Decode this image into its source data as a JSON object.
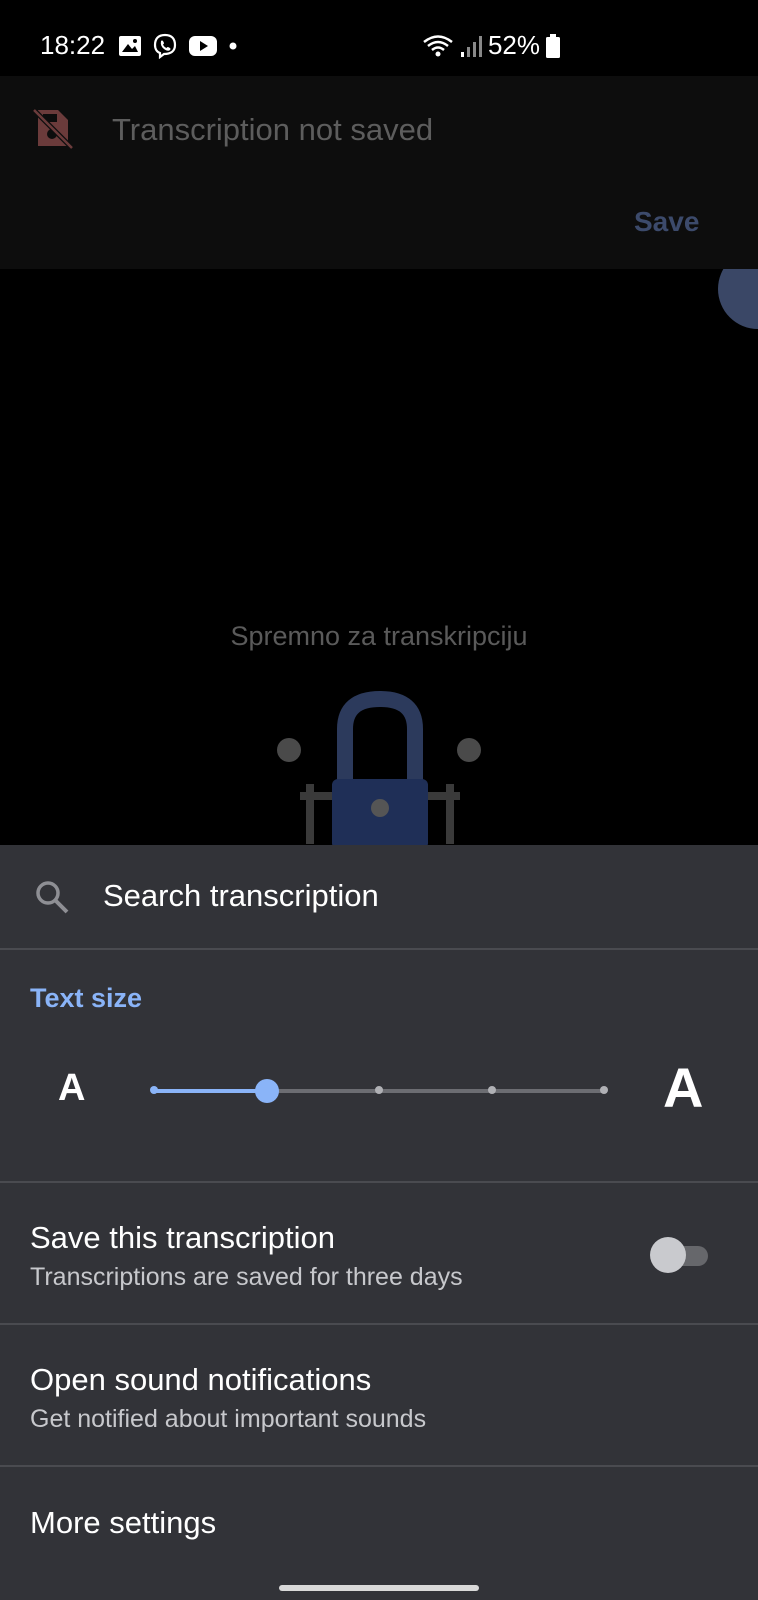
{
  "status_bar": {
    "time": "18:22",
    "battery": "52%"
  },
  "banner": {
    "title": "Transcription not saved",
    "save_label": "Save",
    "icon": "no-save-icon"
  },
  "main": {
    "ready_text": "Spremno za transkripciju",
    "illustration": "lock-robot-illustration"
  },
  "sheet": {
    "search_label": "Search transcription",
    "text_size": {
      "title": "Text size",
      "small_label": "A",
      "large_label": "A",
      "steps": 5,
      "selected_step": 2
    },
    "save_transcription": {
      "title": "Save this transcription",
      "subtitle": "Transcriptions are saved for three days",
      "enabled": false
    },
    "sound_notifications": {
      "title": "Open sound notifications",
      "subtitle": "Get notified about important sounds"
    },
    "more_settings": "More settings"
  },
  "colors": {
    "accent": "#8ab4f8",
    "sheet_bg": "#323338",
    "banner_bg": "#0d0d0d"
  }
}
